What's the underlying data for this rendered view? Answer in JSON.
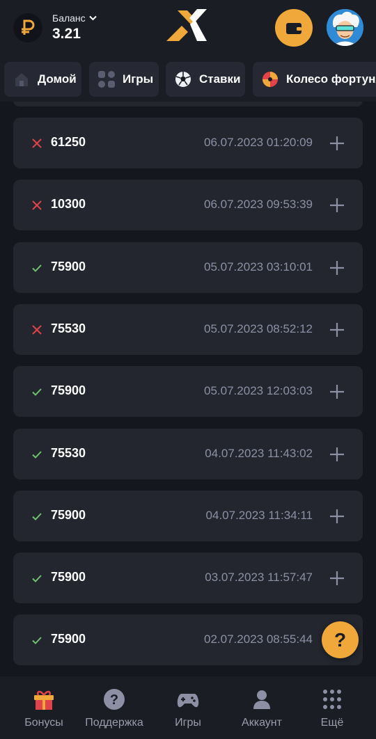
{
  "header": {
    "balance_label": "Баланс",
    "balance_value": "3.21",
    "currency_icon": "ruble-icon",
    "accent_color": "#f0a83a"
  },
  "nav": {
    "items": [
      {
        "label": "Домой",
        "icon": "home-icon"
      },
      {
        "label": "Игры",
        "icon": "games-grid-icon"
      },
      {
        "label": "Ставки",
        "icon": "soccer-ball-icon"
      },
      {
        "label": "Колесо фортуны",
        "icon": "fortune-wheel-icon"
      }
    ]
  },
  "transactions": [
    {
      "status": "lost",
      "amount": "61250",
      "date": "06.07.2023 01:20:09"
    },
    {
      "status": "lost",
      "amount": "10300",
      "date": "06.07.2023 09:53:39"
    },
    {
      "status": "won",
      "amount": "75900",
      "date": "05.07.2023 03:10:01"
    },
    {
      "status": "lost",
      "amount": "75530",
      "date": "05.07.2023 08:52:12"
    },
    {
      "status": "won",
      "amount": "75900",
      "date": "05.07.2023 12:03:03"
    },
    {
      "status": "won",
      "amount": "75530",
      "date": "04.07.2023 11:43:02"
    },
    {
      "status": "won",
      "amount": "75900",
      "date": "04.07.2023 11:34:11"
    },
    {
      "status": "won",
      "amount": "75900",
      "date": "03.07.2023 11:57:47"
    },
    {
      "status": "won",
      "amount": "75900",
      "date": "02.07.2023 08:55:44"
    }
  ],
  "help_fab": {
    "label": "?"
  },
  "bottom_nav": {
    "items": [
      {
        "label": "Бонусы",
        "icon": "gift-icon"
      },
      {
        "label": "Поддержка",
        "icon": "help-circle-icon"
      },
      {
        "label": "Игры",
        "icon": "gamepad-icon"
      },
      {
        "label": "Аккаунт",
        "icon": "user-icon"
      },
      {
        "label": "Ещё",
        "icon": "more-dots-icon"
      }
    ]
  },
  "colors": {
    "lost": "#e2434b",
    "won": "#6fc46e",
    "muted": "#8d90a4"
  }
}
